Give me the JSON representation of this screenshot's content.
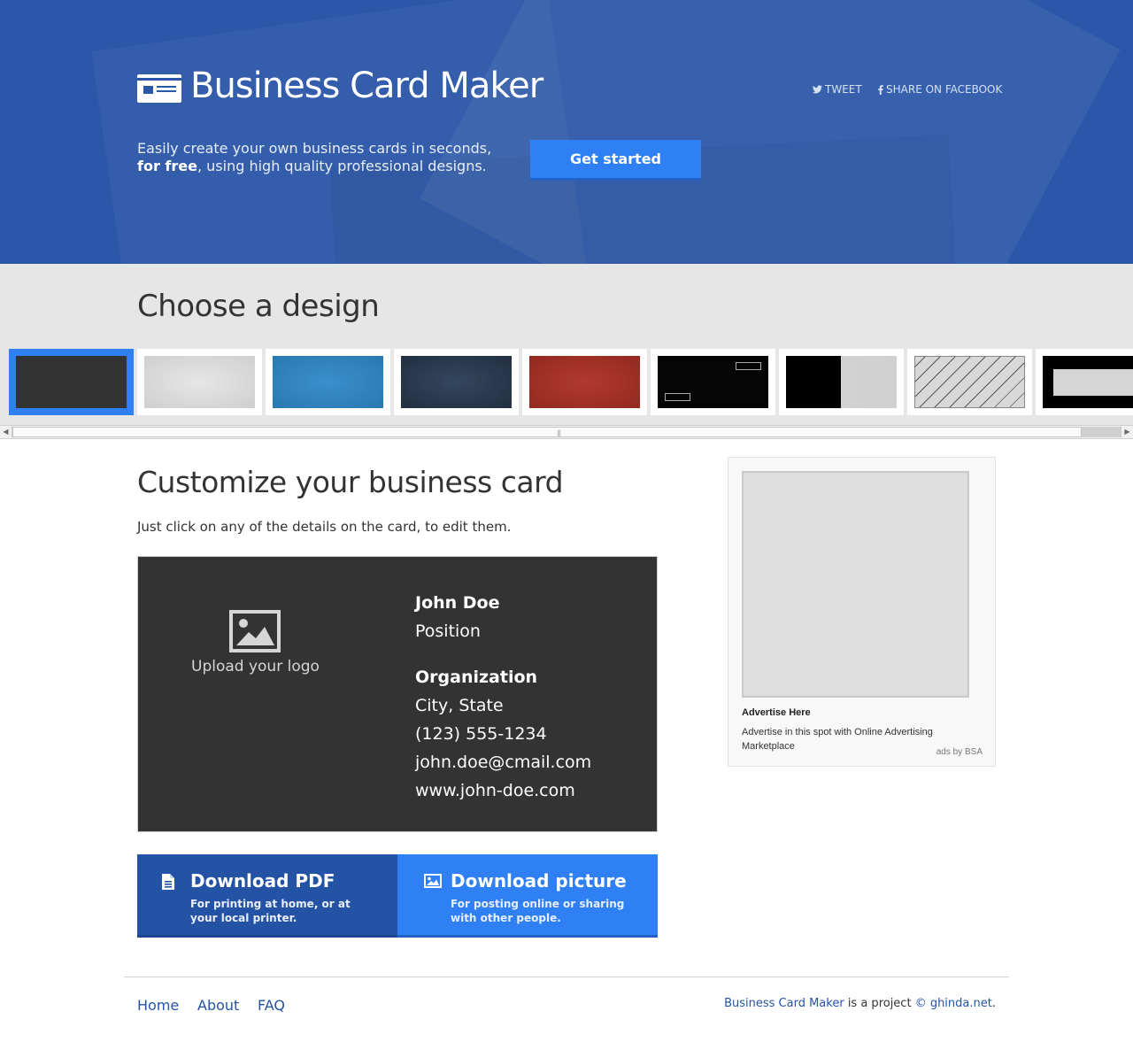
{
  "header": {
    "title": "Business Card Maker",
    "share_tweet": "TWEET",
    "share_facebook": "SHARE ON FACEBOOK",
    "tagline_line1": "Easily create your own business cards in seconds,",
    "tagline_bold": "for free",
    "tagline_rest": ", using high quality professional designs.",
    "cta_label": "Get started",
    "bg_color": "#2b57a8",
    "cta_color": "#2f7ff5"
  },
  "designs": {
    "title": "Choose a design",
    "selected_index": 0,
    "thumbnails": [
      {
        "name": "dark-gray"
      },
      {
        "name": "light-gray"
      },
      {
        "name": "blue"
      },
      {
        "name": "navy"
      },
      {
        "name": "red"
      },
      {
        "name": "black-boxes"
      },
      {
        "name": "black-gray-split"
      },
      {
        "name": "diagonal-stripes"
      },
      {
        "name": "black-frame"
      }
    ]
  },
  "main": {
    "title": "Customize your business card",
    "subtitle": "Just click on any of the details on the card, to edit them."
  },
  "card": {
    "upload_label": "Upload your logo",
    "name": "John Doe",
    "position": "Position",
    "organization": "Organization",
    "city_state": "City, State",
    "phone": "(123) 555-1234",
    "email": "john.doe@cmail.com",
    "website": "www.john-doe.com",
    "bg_color": "#333333"
  },
  "downloads": {
    "pdf_title": "Download PDF",
    "pdf_desc": "For printing at home, or at your local printer.",
    "picture_title": "Download picture",
    "picture_desc": "For posting online or sharing with other people."
  },
  "ad": {
    "title": "Advertise Here",
    "description": "Advertise in this spot with Online Advertising Marketplace",
    "by": "ads by BSA"
  },
  "footer": {
    "links": [
      "Home",
      "About",
      "FAQ"
    ],
    "credit_site": "Business Card Maker",
    "credit_mid": " is a project ",
    "credit_link": "© ghinda.net",
    "credit_end": "."
  }
}
